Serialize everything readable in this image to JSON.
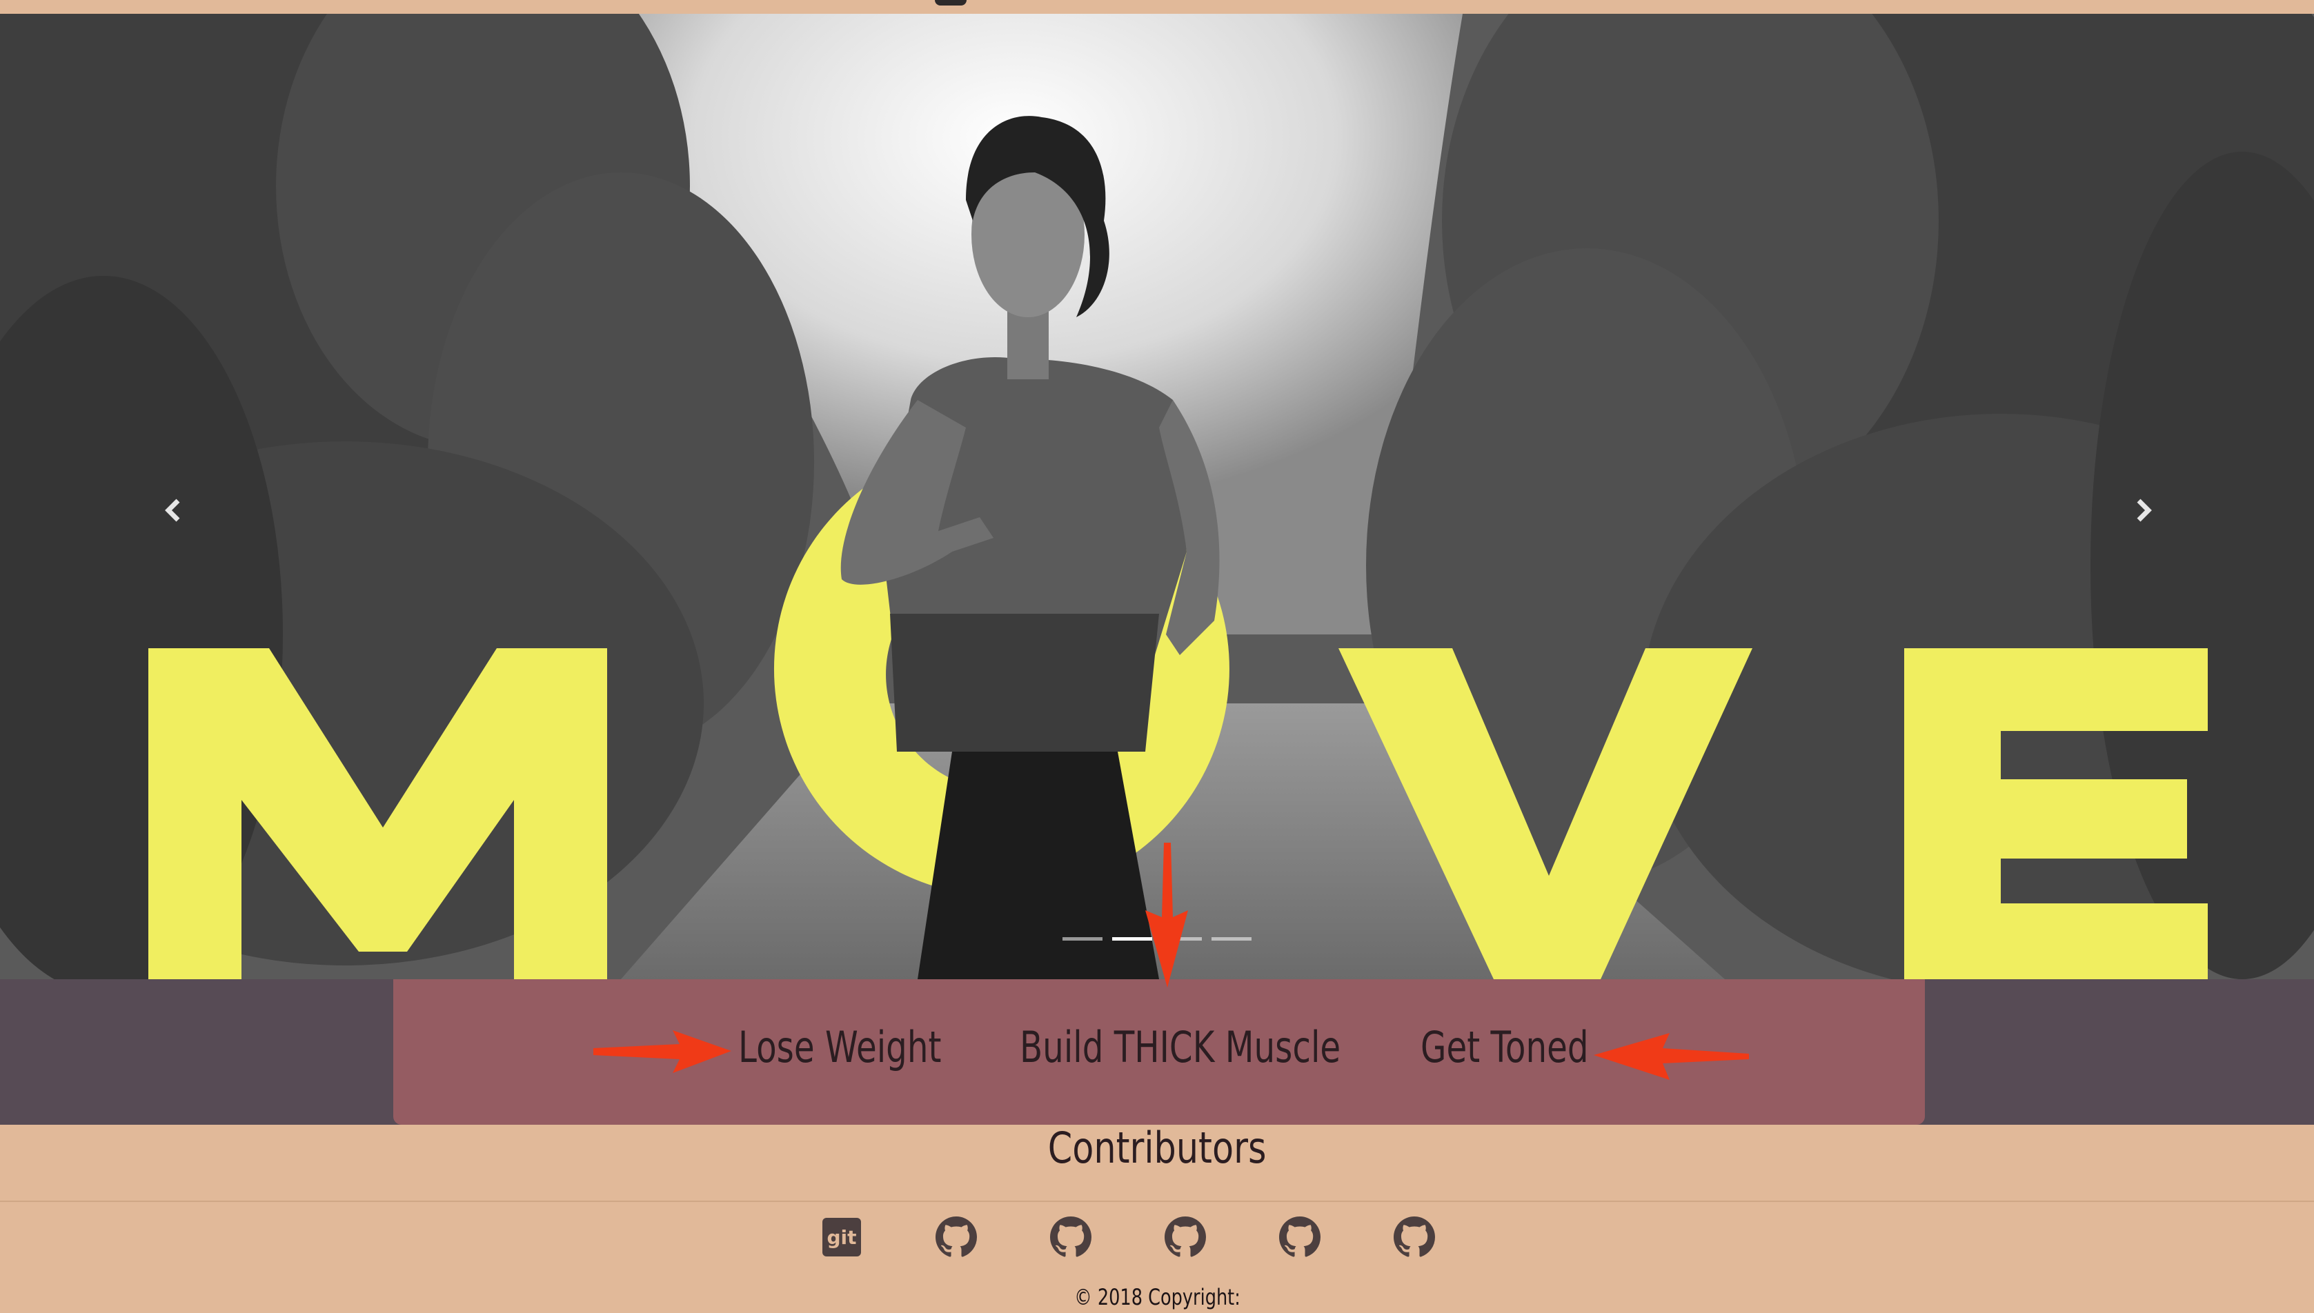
{
  "hero": {
    "word": "MOVE",
    "prev_label": "‹",
    "next_label": "›",
    "slides": 4,
    "active_slide": 2
  },
  "programs": [
    {
      "label": "Lose Weight"
    },
    {
      "label": "Build THICK Muscle"
    },
    {
      "label": "Get Toned"
    }
  ],
  "contributors": {
    "title": "Contributors",
    "icons": [
      "git-icon",
      "github-icon",
      "github-icon",
      "github-icon",
      "github-icon",
      "github-icon"
    ]
  },
  "footer": {
    "copyright": "© 2018 Copyright:"
  },
  "colors": {
    "page_bg": "#e1b999",
    "band_bg": "#574b55",
    "card_bg": "#955c62",
    "word_yellow": "#f0ee60",
    "arrow_red": "#f03a17"
  }
}
